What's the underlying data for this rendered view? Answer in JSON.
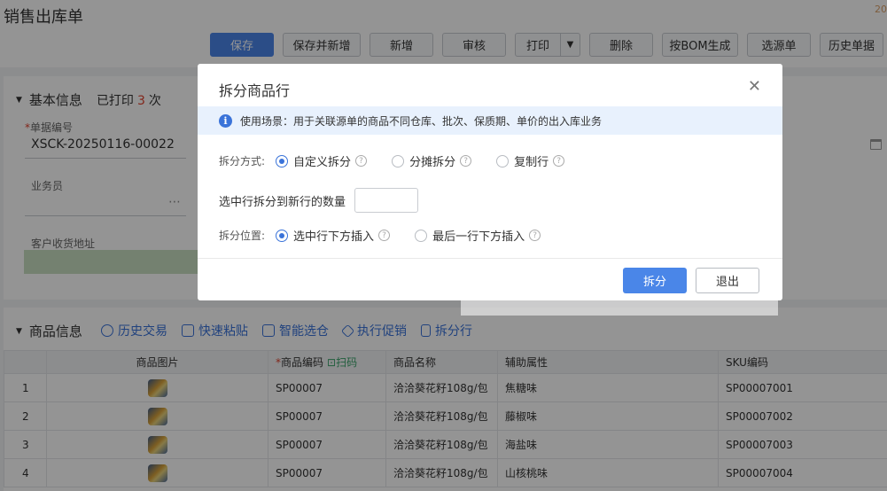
{
  "page": {
    "title": "销售出库单",
    "corner_text": "20"
  },
  "toolbar": {
    "save": "保存",
    "save_new": "保存并新增",
    "add": "新增",
    "audit": "审核",
    "print": "打印",
    "delete": "删除",
    "bom": "按BOM生成",
    "source": "选源单",
    "history": "历史单据"
  },
  "basic": {
    "section": "基本信息",
    "printed_prefix": "已打印",
    "printed_count": "3",
    "printed_suffix": "次",
    "doc_no_label": "单据编号",
    "doc_no": "XSCK-20250116-00022",
    "salesman_label": "业务员",
    "address_label": "客户收货地址"
  },
  "goods": {
    "section": "商品信息",
    "links": [
      "历史交易",
      "快速粘贴",
      "智能选仓",
      "执行促销",
      "拆分行"
    ],
    "columns": {
      "image": "商品图片",
      "code": "商品编码",
      "scan": "扫码",
      "name": "商品名称",
      "attr": "辅助属性",
      "sku": "SKU编码"
    },
    "rows": [
      {
        "idx": "1",
        "code": "SP00007",
        "name": "洽洽葵花籽108g/包",
        "attr": "焦糖味",
        "sku": "SP00007001"
      },
      {
        "idx": "2",
        "code": "SP00007",
        "name": "洽洽葵花籽108g/包",
        "attr": "藤椒味",
        "sku": "SP00007002"
      },
      {
        "idx": "3",
        "code": "SP00007",
        "name": "洽洽葵花籽108g/包",
        "attr": "海盐味",
        "sku": "SP00007003"
      },
      {
        "idx": "4",
        "code": "SP00007",
        "name": "洽洽葵花籽108g/包",
        "attr": "山核桃味",
        "sku": "SP00007004"
      }
    ]
  },
  "modal": {
    "title": "拆分商品行",
    "tip": "使用场景：用于关联源单的商品不同仓库、批次、保质期、单价的出入库业务",
    "mode_label": "拆分方式:",
    "mode_options": [
      "自定义拆分",
      "分摊拆分",
      "复制行"
    ],
    "mode_selected": "自定义拆分",
    "qty_label": "选中行拆分到新行的数量",
    "qty_value": "",
    "position_label": "拆分位置:",
    "position_options": [
      "选中行下方插入",
      "最后一行下方插入"
    ],
    "position_selected": "选中行下方插入",
    "split_button": "拆分",
    "exit_button": "退出"
  },
  "colors": {
    "primary": "#4a86e8",
    "link": "#3a73d9",
    "danger": "#e0432f"
  }
}
